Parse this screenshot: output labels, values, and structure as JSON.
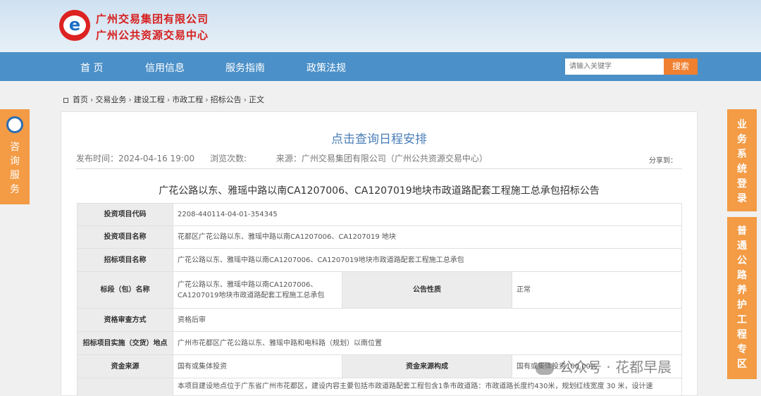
{
  "header": {
    "logo_char": "e",
    "org_line1": "广州交易集团有限公司",
    "org_line2": "广州公共资源交易中心"
  },
  "nav": {
    "items": [
      "首 页",
      "信用信息",
      "服务指南",
      "政策法规"
    ],
    "search_placeholder": "请输入关键字",
    "search_button": "搜索"
  },
  "breadcrumb": [
    "首页",
    "交易业务",
    "建设工程",
    "市政工程",
    "招标公告",
    "正文"
  ],
  "article": {
    "page_title": "点击查询日程安排",
    "publish_time": "发布时间：2024-04-16 19:00",
    "views": "浏览次数:",
    "source": "来源：广州交易集团有限公司（广州公共资源交易中心）",
    "share": "分享到：",
    "doc_title": "广花公路以东、雅瑶中路以南CA1207006、CA1207019地块市政道路配套工程施工总承包招标公告"
  },
  "table": {
    "r1_label": "投资项目代码",
    "r1_value": "2208-440114-04-01-354345",
    "r2_label": "投资项目名称",
    "r2_value": "花都区广花公路以东、雅瑶中路以南CA1207006、CA1207019 地块",
    "r3_label": "招标项目名称",
    "r3_value": "广花公路以东、雅瑶中路以南CA1207006、CA1207019地块市政道路配套工程施工总承包",
    "r4_label": "标段（包）名称",
    "r4_value": "广花公路以东、雅瑶中路以南CA1207006、CA1207019地块市政道路配套工程施工总承包",
    "r4_label2": "公告性质",
    "r4_value2": "正常",
    "r5_label": "资格审查方式",
    "r5_value": "资格后审",
    "r6_label": "招标项目实施（交货）地点",
    "r6_value": "广州市花都区广花公路以东、雅瑶中路和电科路（规划）以南位置",
    "r7_label": "资金来源",
    "r7_value": "国有或集体投资",
    "r7_label2": "资金来源构成",
    "r7_value2": "国有或集体投资100.00%",
    "r8_value": "本项目建设地点位于广东省广州市花都区，建设内容主要包括市政道路配套工程包含1条市政道路：市政道路长度约430米，规划红线宽度 30 米，设计速"
  },
  "side": {
    "left": "咨询服务",
    "right1": "业务系统登录",
    "right2": "普通公路养护工程专区"
  },
  "watermark": "公众号 · 花都早晨"
}
